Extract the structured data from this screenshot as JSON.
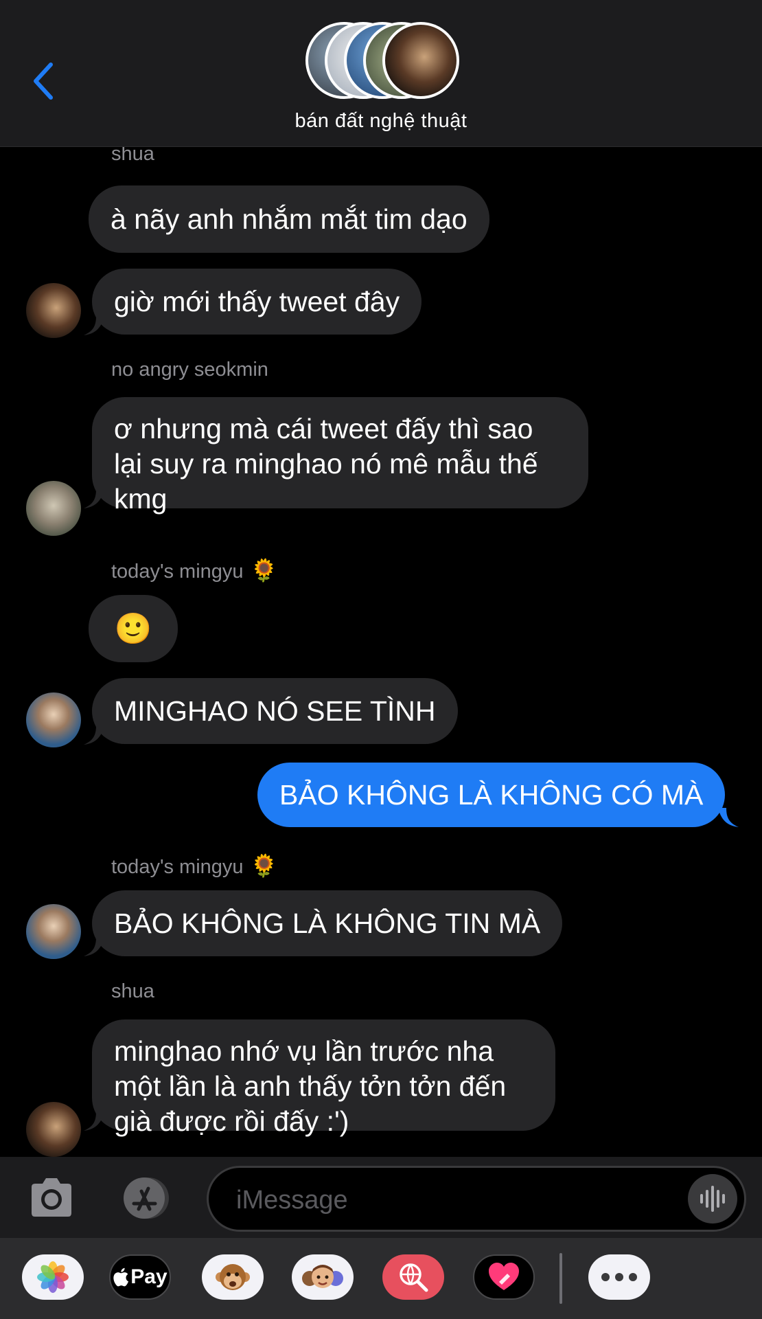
{
  "header": {
    "group_name": "bán đất nghệ thuật"
  },
  "messages": [
    {
      "sender": "shua",
      "text": "à nãy anh nhắm mắt tim dạo"
    },
    {
      "text": "giờ mới thấy tweet đây"
    },
    {
      "sender": "no angry seokmin",
      "lines": [
        "ơ nhưng mà cái tweet đấy thì sao",
        "lại suy ra minghao nó mê mẫu thế",
        "kmg"
      ]
    },
    {
      "sender": "today's mingyu",
      "sender_emoji": "🌻",
      "text": "🙂"
    },
    {
      "text": "MINGHAO NÓ SEE TÌNH"
    },
    {
      "text": "BẢO KHÔNG LÀ KHÔNG CÓ MÀ",
      "outgoing": true
    },
    {
      "sender": "today's mingyu",
      "sender_emoji": "🌻",
      "text": "BẢO KHÔNG LÀ KHÔNG TIN MÀ"
    },
    {
      "sender": "shua",
      "lines": [
        "minghao nhớ vụ lần trước nha",
        "một lần là anh thấy tởn tởn đến",
        "già được rồi đấy :')"
      ]
    }
  ],
  "input": {
    "placeholder": "iMessage"
  },
  "apps": {
    "pay_label": "Pay"
  },
  "colors": {
    "header_bg": "#1c1c1e",
    "incoming_bubble": "#262628",
    "outgoing_bubble": "#1f7cf5",
    "back_chevron": "#1f7cf5"
  }
}
